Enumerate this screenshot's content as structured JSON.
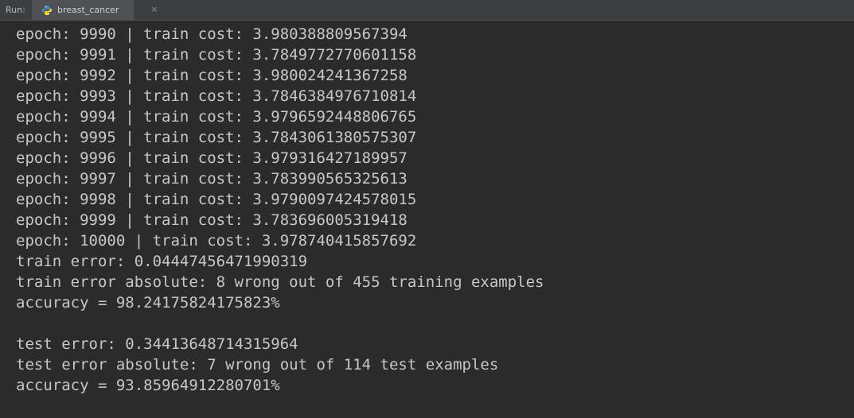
{
  "run_bar": {
    "label": "Run:",
    "tab": {
      "title": "breast_cancer",
      "icon": "python-icon",
      "close_glyph": "×"
    }
  },
  "console": {
    "lines": [
      "epoch: 9990 | train cost: 3.980388809567394",
      "epoch: 9991 | train cost: 3.7849772770601158",
      "epoch: 9992 | train cost: 3.980024241367258",
      "epoch: 9993 | train cost: 3.7846384976710814",
      "epoch: 9994 | train cost: 3.9796592448806765",
      "epoch: 9995 | train cost: 3.7843061380575307",
      "epoch: 9996 | train cost: 3.979316427189957",
      "epoch: 9997 | train cost: 3.783990565325613",
      "epoch: 9998 | train cost: 3.9790097424578015",
      "epoch: 9999 | train cost: 3.783696005319418",
      "epoch: 10000 | train cost: 3.978740415857692",
      "train error: 0.04447456471990319",
      "train error absolute: 8 wrong out of 455 training examples",
      "accuracy = 98.24175824175823%",
      "",
      "test error: 0.34413648714315964",
      "test error absolute: 7 wrong out of 114 test examples",
      "accuracy = 93.85964912280701%"
    ]
  }
}
